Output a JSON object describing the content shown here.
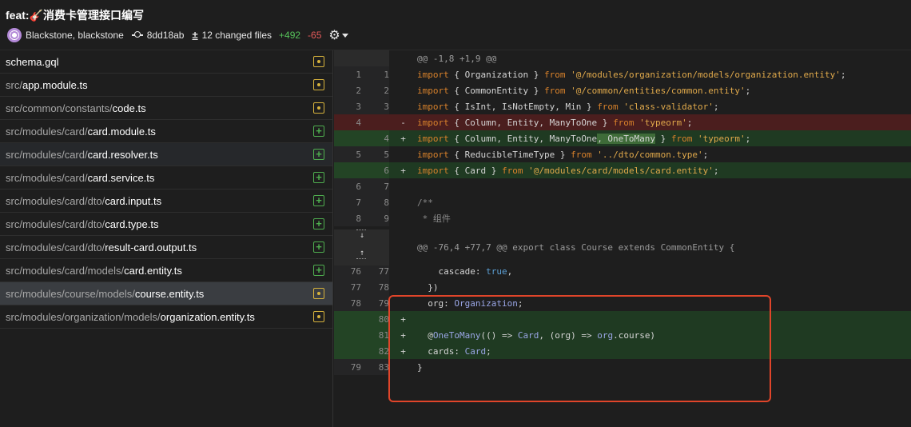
{
  "header": {
    "title": "feat:🎸消费卡管理接口编写",
    "author": "Blackstone, blackstone",
    "commit_hash": "8dd18ab",
    "changed_files": "12 changed files",
    "additions": "+492",
    "deletions": "-65"
  },
  "files": [
    {
      "dir": "",
      "name": "schema.gql",
      "status": "modified"
    },
    {
      "dir": "src/",
      "name": "app.module.ts",
      "status": "modified"
    },
    {
      "dir": "src/common/constants/",
      "name": "code.ts",
      "status": "modified"
    },
    {
      "dir": "src/modules/card/",
      "name": "card.module.ts",
      "status": "added"
    },
    {
      "dir": "src/modules/card/",
      "name": "card.resolver.ts",
      "status": "added"
    },
    {
      "dir": "src/modules/card/",
      "name": "card.service.ts",
      "status": "added"
    },
    {
      "dir": "src/modules/card/dto/",
      "name": "card.input.ts",
      "status": "added"
    },
    {
      "dir": "src/modules/card/dto/",
      "name": "card.type.ts",
      "status": "added"
    },
    {
      "dir": "src/modules/card/dto/",
      "name": "result-card.output.ts",
      "status": "added"
    },
    {
      "dir": "src/modules/card/models/",
      "name": "card.entity.ts",
      "status": "added"
    },
    {
      "dir": "src/modules/course/models/",
      "name": "course.entity.ts",
      "status": "modified"
    },
    {
      "dir": "src/modules/organization/models/",
      "name": "organization.entity.ts",
      "status": "modified"
    }
  ],
  "diff_lines": [
    {
      "type": "hunk",
      "old": "",
      "new": "",
      "mark": "",
      "tokens": [
        [
          "c",
          "@@ -1,8 +1,9 @@"
        ]
      ]
    },
    {
      "type": "ctx",
      "old": "1",
      "new": "1",
      "mark": "",
      "tokens": [
        [
          "kw",
          "import"
        ],
        [
          "p",
          " { Organization } "
        ],
        [
          "kw",
          "from"
        ],
        [
          "p",
          " "
        ],
        [
          "str",
          "'@/modules/organization/models/organization.entity'"
        ],
        [
          "p",
          ";"
        ]
      ]
    },
    {
      "type": "ctx",
      "old": "2",
      "new": "2",
      "mark": "",
      "tokens": [
        [
          "kw",
          "import"
        ],
        [
          "p",
          " { CommonEntity } "
        ],
        [
          "kw",
          "from"
        ],
        [
          "p",
          " "
        ],
        [
          "str",
          "'@/common/entities/common.entity'"
        ],
        [
          "p",
          ";"
        ]
      ]
    },
    {
      "type": "ctx",
      "old": "3",
      "new": "3",
      "mark": "",
      "tokens": [
        [
          "kw",
          "import"
        ],
        [
          "p",
          " { IsInt, IsNotEmpty, Min } "
        ],
        [
          "kw",
          "from"
        ],
        [
          "p",
          " "
        ],
        [
          "str",
          "'class-validator'"
        ],
        [
          "p",
          ";"
        ]
      ]
    },
    {
      "type": "del",
      "old": "4",
      "new": "",
      "mark": "-",
      "tokens": [
        [
          "kw",
          "import"
        ],
        [
          "p",
          " { Column, Entity, ManyToOne } "
        ],
        [
          "kw",
          "from"
        ],
        [
          "p",
          " "
        ],
        [
          "str",
          "'typeorm'"
        ],
        [
          "p",
          ";"
        ]
      ]
    },
    {
      "type": "add",
      "old": "",
      "new": "4",
      "mark": "+",
      "tokens": [
        [
          "kw",
          "import"
        ],
        [
          "p",
          " { Column, Entity, ManyToOne"
        ],
        [
          "hl",
          ", OneToMany"
        ],
        [
          "p",
          " } "
        ],
        [
          "kw",
          "from"
        ],
        [
          "p",
          " "
        ],
        [
          "str",
          "'typeorm'"
        ],
        [
          "p",
          ";"
        ]
      ]
    },
    {
      "type": "ctx",
      "old": "5",
      "new": "5",
      "mark": "",
      "tokens": [
        [
          "kw",
          "import"
        ],
        [
          "p",
          " { ReducibleTimeType } "
        ],
        [
          "kw",
          "from"
        ],
        [
          "p",
          " "
        ],
        [
          "str",
          "'../dto/common.type'"
        ],
        [
          "p",
          ";"
        ]
      ]
    },
    {
      "type": "add",
      "old": "",
      "new": "6",
      "mark": "+",
      "tokens": [
        [
          "kw",
          "import"
        ],
        [
          "p",
          " { Card } "
        ],
        [
          "kw",
          "from"
        ],
        [
          "p",
          " "
        ],
        [
          "str",
          "'@/modules/card/models/card.entity'"
        ],
        [
          "p",
          ";"
        ]
      ]
    },
    {
      "type": "ctx",
      "old": "6",
      "new": "7",
      "mark": "",
      "tokens": []
    },
    {
      "type": "ctx",
      "old": "7",
      "new": "8",
      "mark": "",
      "tokens": [
        [
          "cm",
          "/**"
        ]
      ]
    },
    {
      "type": "ctx",
      "old": "8",
      "new": "9",
      "mark": "",
      "tokens": [
        [
          "cm",
          " * 组件"
        ]
      ]
    },
    {
      "type": "hunk2",
      "old": "",
      "new": "",
      "mark": "",
      "tokens": [
        [
          "c",
          "@@ -76,4 +77,7 @@ export class Course extends CommonEntity {"
        ]
      ]
    },
    {
      "type": "ctx",
      "old": "76",
      "new": "77",
      "mark": "",
      "tokens": [
        [
          "p",
          "    cascade: "
        ],
        [
          "tr",
          "true"
        ],
        [
          "p",
          ","
        ]
      ]
    },
    {
      "type": "ctx",
      "old": "77",
      "new": "78",
      "mark": "",
      "tokens": [
        [
          "p",
          "  })"
        ]
      ]
    },
    {
      "type": "ctx",
      "old": "78",
      "new": "79",
      "mark": "",
      "tokens": [
        [
          "p",
          "  org: "
        ],
        [
          "ty",
          "Organization"
        ],
        [
          "p",
          ";"
        ]
      ]
    },
    {
      "type": "add",
      "old": "",
      "new": "80",
      "mark": "+",
      "tokens": []
    },
    {
      "type": "add",
      "old": "",
      "new": "81",
      "mark": "+",
      "tokens": [
        [
          "p",
          "  @"
        ],
        [
          "ty",
          "OneToMany"
        ],
        [
          "p",
          "(() => "
        ],
        [
          "ty",
          "Card"
        ],
        [
          "p",
          ", (org) => "
        ],
        [
          "ty",
          "org"
        ],
        [
          "p",
          ".course)"
        ]
      ]
    },
    {
      "type": "add",
      "old": "",
      "new": "82",
      "mark": "+",
      "tokens": [
        [
          "p",
          "  cards: "
        ],
        [
          "ty",
          "Card"
        ],
        [
          "p",
          ";"
        ]
      ]
    },
    {
      "type": "ctx",
      "old": "79",
      "new": "83",
      "mark": "",
      "tokens": [
        [
          "p",
          "}"
        ]
      ]
    }
  ],
  "expand": {
    "down_icon": "↓",
    "up_icon": "↑"
  },
  "icons": {
    "gear": "⚙"
  },
  "colors": {
    "added": "#56c25a",
    "deleted": "#e55a5a",
    "modified_badge": "#d6b23c",
    "annotation": "#e0452a"
  }
}
